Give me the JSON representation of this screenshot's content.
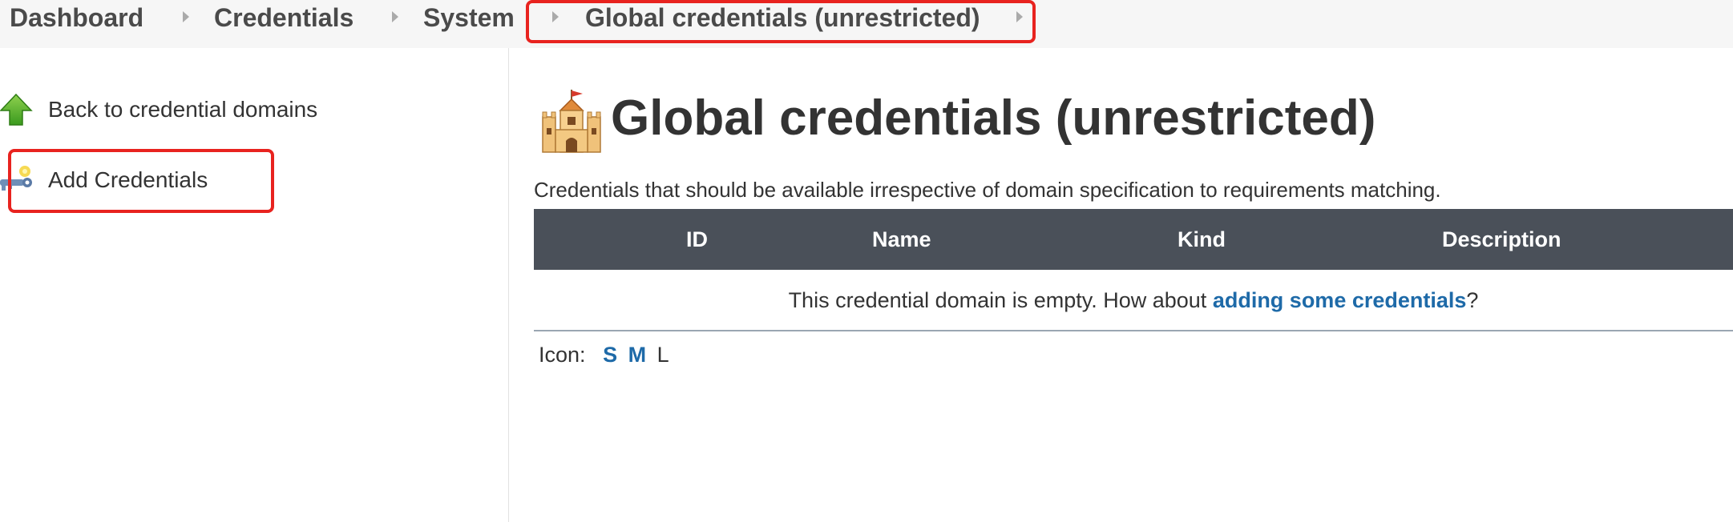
{
  "breadcrumb": {
    "items": [
      "Dashboard",
      "Credentials",
      "System",
      "Global credentials (unrestricted)"
    ]
  },
  "sidebar": {
    "back_label": "Back to credential domains",
    "add_label": "Add Credentials",
    "back_icon": "arrow-up-icon",
    "add_icon": "key-icon"
  },
  "main": {
    "title": "Global credentials (unrestricted)",
    "title_icon": "castle-icon",
    "description": "Credentials that should be available irrespective of domain specification to requirements matching.",
    "table": {
      "headers": [
        "ID",
        "Name",
        "Kind",
        "Description"
      ],
      "empty_prefix": "This credential domain is empty. How about ",
      "empty_link": "adding some credentials",
      "empty_suffix": "?"
    },
    "icon_sizes": {
      "label": "Icon:",
      "small": "S",
      "medium": "M",
      "large": "L",
      "current": "L"
    }
  },
  "colors": {
    "highlight": "#e8231f",
    "link": "#1e6aa8",
    "table_header_bg": "#4a5059",
    "breadcrumb_bg": "#f6f6f6"
  }
}
